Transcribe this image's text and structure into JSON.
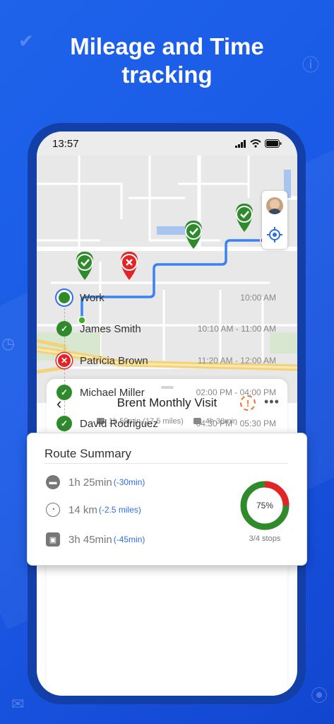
{
  "promo": {
    "headline_line1": "Mileage and Time",
    "headline_line2": "tracking"
  },
  "status_bar": {
    "time": "13:57"
  },
  "colors": {
    "background": "#1a5ae6",
    "route": "#3b82f0",
    "stop_done": "#2f8a2c",
    "stop_missed": "#e32424",
    "delta_text": "#2d6fe0"
  },
  "map": {
    "controls": [
      {
        "name": "user-avatar",
        "icon": "avatar"
      },
      {
        "name": "my-location",
        "icon": "crosshair-icon"
      }
    ]
  },
  "visit": {
    "title": "Brent Monthly Visit",
    "drive_meta": "1h 55min (17.5 miles)",
    "work_meta": "4h 30min"
  },
  "route_summary": {
    "title": "Route Summary",
    "drive_time": "1h 25min",
    "drive_delta": "(-30min)",
    "distance": "14 km",
    "distance_delta": "(-2.5 miles)",
    "work_time": "3h 45min",
    "work_delta": "(-45min)",
    "progress_percent": 75,
    "progress_label": "75%",
    "stops_label": "3/4 stops"
  },
  "stops": [
    {
      "name": "Work",
      "time": "10:00 AM",
      "status": "start"
    },
    {
      "name": "James Smith",
      "time": "10:10 AM - 11:00 AM",
      "status": "done"
    },
    {
      "name": "Patricia Brown",
      "time": "11:20 AM - 12:00 AM",
      "status": "missed"
    },
    {
      "name": "Michael Miller",
      "time": "02:00 PM - 04:00 PM",
      "status": "done"
    },
    {
      "name": "David Rodriguez",
      "time": "04:30 PM - 05:30 PM",
      "status": "done"
    }
  ]
}
